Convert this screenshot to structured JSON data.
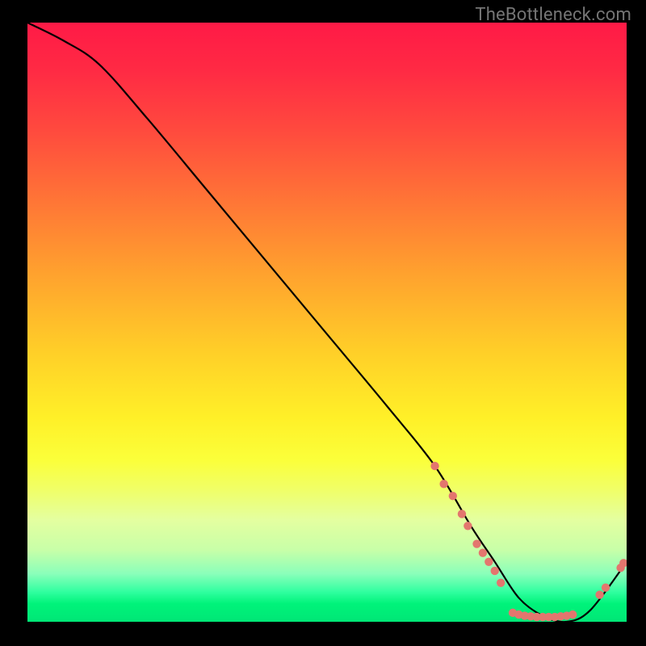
{
  "watermark": "TheBottleneck.com",
  "chart_data": {
    "type": "line",
    "title": "",
    "xlabel": "",
    "ylabel": "",
    "x_range": [
      0,
      100
    ],
    "y_range": [
      0,
      100
    ],
    "series": [
      {
        "name": "curve",
        "x": [
          0,
          6,
          12,
          20,
          30,
          40,
          50,
          60,
          68,
          74,
          78,
          82,
          86,
          90,
          94,
          100
        ],
        "y": [
          100,
          97,
          93,
          84,
          72,
          60,
          48,
          36,
          26,
          16,
          10,
          4,
          1,
          0,
          2,
          10
        ],
        "color": "#000000"
      }
    ],
    "markers": [
      {
        "x": 68.0,
        "y": 26.0
      },
      {
        "x": 69.5,
        "y": 23.0
      },
      {
        "x": 71.0,
        "y": 21.0
      },
      {
        "x": 72.5,
        "y": 18.0
      },
      {
        "x": 73.5,
        "y": 16.0
      },
      {
        "x": 75.0,
        "y": 13.0
      },
      {
        "x": 76.0,
        "y": 11.5
      },
      {
        "x": 77.0,
        "y": 10.0
      },
      {
        "x": 78.0,
        "y": 8.5
      },
      {
        "x": 79.0,
        "y": 6.5
      },
      {
        "x": 81.0,
        "y": 1.5
      },
      {
        "x": 82.0,
        "y": 1.2
      },
      {
        "x": 83.0,
        "y": 1.0
      },
      {
        "x": 84.0,
        "y": 0.9
      },
      {
        "x": 85.0,
        "y": 0.8
      },
      {
        "x": 86.0,
        "y": 0.8
      },
      {
        "x": 87.0,
        "y": 0.8
      },
      {
        "x": 88.0,
        "y": 0.8
      },
      {
        "x": 89.0,
        "y": 0.9
      },
      {
        "x": 90.0,
        "y": 1.0
      },
      {
        "x": 91.0,
        "y": 1.2
      },
      {
        "x": 95.5,
        "y": 4.5
      },
      {
        "x": 96.5,
        "y": 5.7
      },
      {
        "x": 99.0,
        "y": 9.0
      },
      {
        "x": 99.5,
        "y": 9.8
      }
    ],
    "marker_color": "#e3766e",
    "background_gradient": [
      {
        "stop": 0.0,
        "color": "#ff1a46"
      },
      {
        "stop": 0.3,
        "color": "#ff7636"
      },
      {
        "stop": 0.55,
        "color": "#ffcf28"
      },
      {
        "stop": 0.73,
        "color": "#fbff3a"
      },
      {
        "stop": 0.88,
        "color": "#c8ffa8"
      },
      {
        "stop": 1.0,
        "color": "#00e676"
      }
    ]
  }
}
